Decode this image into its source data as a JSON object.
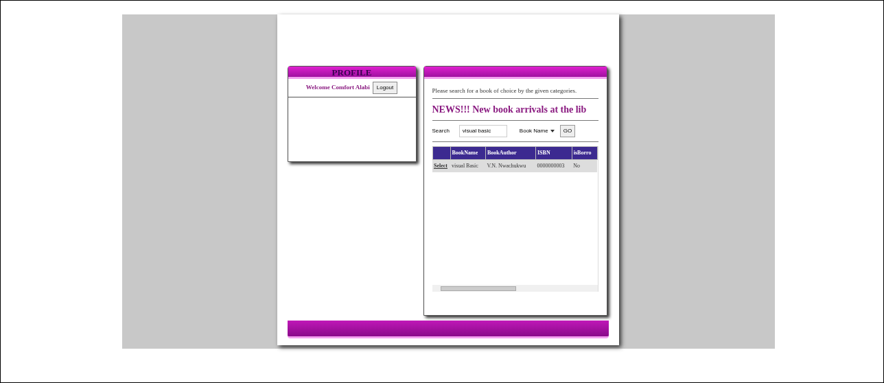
{
  "profile": {
    "title": "PROFILE",
    "welcome": "Welcome Comfort Alabi",
    "logout": "Logout"
  },
  "search_panel": {
    "intro": "Please search for a book of choice by the given categories.",
    "news": "NEWS!!! New book arrivals at the lib",
    "search_label": "Search",
    "search_value": "visual basic",
    "category": "Book Name",
    "go": "GO",
    "table": {
      "columns": [
        "BookName",
        "BookAuthor",
        "ISBN",
        "isBorro"
      ],
      "rows": [
        {
          "action": "Select",
          "cells": [
            "visual Basic",
            "V.N. Nwachukwu",
            "0000000003",
            "No"
          ]
        }
      ]
    }
  }
}
